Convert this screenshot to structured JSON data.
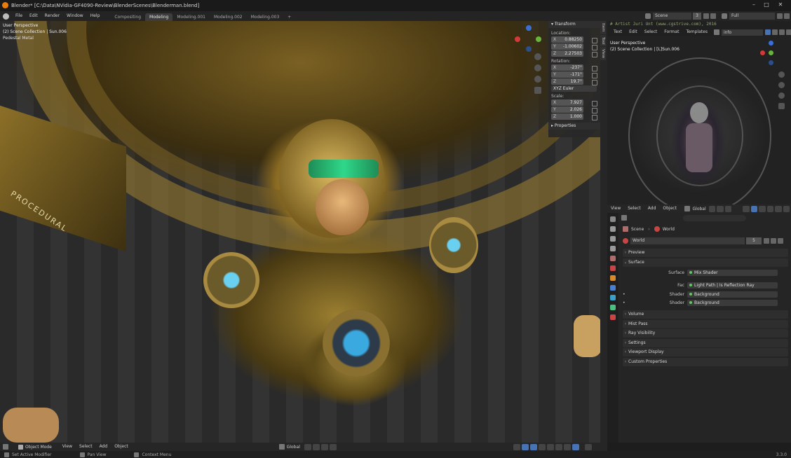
{
  "window": {
    "title": "Blender* [C:\\Data\\NVidia-GF4090-Review\\BlenderScenes\\Blenderman.blend]"
  },
  "menu": {
    "items": [
      "File",
      "Edit",
      "Render",
      "Window",
      "Help"
    ],
    "workspaces": [
      "Compositing",
      "Modeling",
      "Modeling.001",
      "Modeling.002",
      "Modeling.003"
    ],
    "active_workspace": "Modeling",
    "add_tab": "+",
    "scene_label": "Scene",
    "scene_count": "3",
    "viewlayer_label": "Full"
  },
  "viewport": {
    "perspective": "User Perspective",
    "collection": "(2) Scene Collection | Sun.006",
    "extra_line": "Pedestal Metal",
    "decal_text": "PROCEDURAL"
  },
  "transform_panel": {
    "header": "Transform",
    "location_label": "Location:",
    "location": [
      {
        "axis": "X",
        "value": "0.88250"
      },
      {
        "axis": "Y",
        "value": "-1.00602"
      },
      {
        "axis": "Z",
        "value": "2.27503"
      }
    ],
    "rotation_label": "Rotation:",
    "rotation": [
      {
        "axis": "X",
        "value": "-237°"
      },
      {
        "axis": "Y",
        "value": "-171°"
      },
      {
        "axis": "Z",
        "value": "19.7°"
      }
    ],
    "rotation_mode": "XYZ Euler",
    "scale_label": "Scale:",
    "scale": [
      {
        "axis": "X",
        "value": "7.927"
      },
      {
        "axis": "Y",
        "value": "2.026"
      },
      {
        "axis": "Z",
        "value": "1.000"
      }
    ],
    "properties_header": "Properties",
    "tabs": [
      "Item",
      "Tool",
      "View"
    ]
  },
  "text_editor": {
    "comment": "# Artist Juri Unt (www.cgstrive.com), 2016",
    "menus": [
      "Text",
      "Edit",
      "Select",
      "Format",
      "Templates"
    ],
    "file_name": "info"
  },
  "right_viewport": {
    "perspective": "User Perspective",
    "collection": "(2) Scene Collection | [L]Sun.006",
    "menus": [
      "View",
      "Select",
      "Add",
      "Object"
    ],
    "orientation": "Global"
  },
  "properties": {
    "breadcrumb": [
      "Scene",
      "World"
    ],
    "world_name": "World",
    "world_users": "5",
    "panels": {
      "preview": "Preview",
      "surface": "Surface",
      "volume": "Volume",
      "mist_pass": "Mist Pass",
      "ray_visibility": "Ray Visibility",
      "settings": "Settings",
      "viewport_display": "Viewport Display",
      "custom_properties": "Custom Properties"
    },
    "surface_rows": [
      {
        "label": "Surface",
        "value": "Mix Shader"
      },
      {
        "label": "Fac",
        "value": "Light Path | Is Reflection Ray"
      },
      {
        "label": "Shader",
        "value": "Background"
      },
      {
        "label": "Shader",
        "value": "Background"
      }
    ]
  },
  "viewport_footer": {
    "mode": "Object Mode",
    "menus": [
      "View",
      "Select",
      "Add",
      "Object"
    ],
    "orientation": "Global"
  },
  "statusbar": {
    "items": [
      "Set Active Modifier",
      "Pan View",
      "Context Menu"
    ],
    "version": "3.3.0"
  },
  "colors": {
    "accent": "#4772b3",
    "field_dot": "#63c763",
    "active_tab": "#3d3d3d"
  }
}
